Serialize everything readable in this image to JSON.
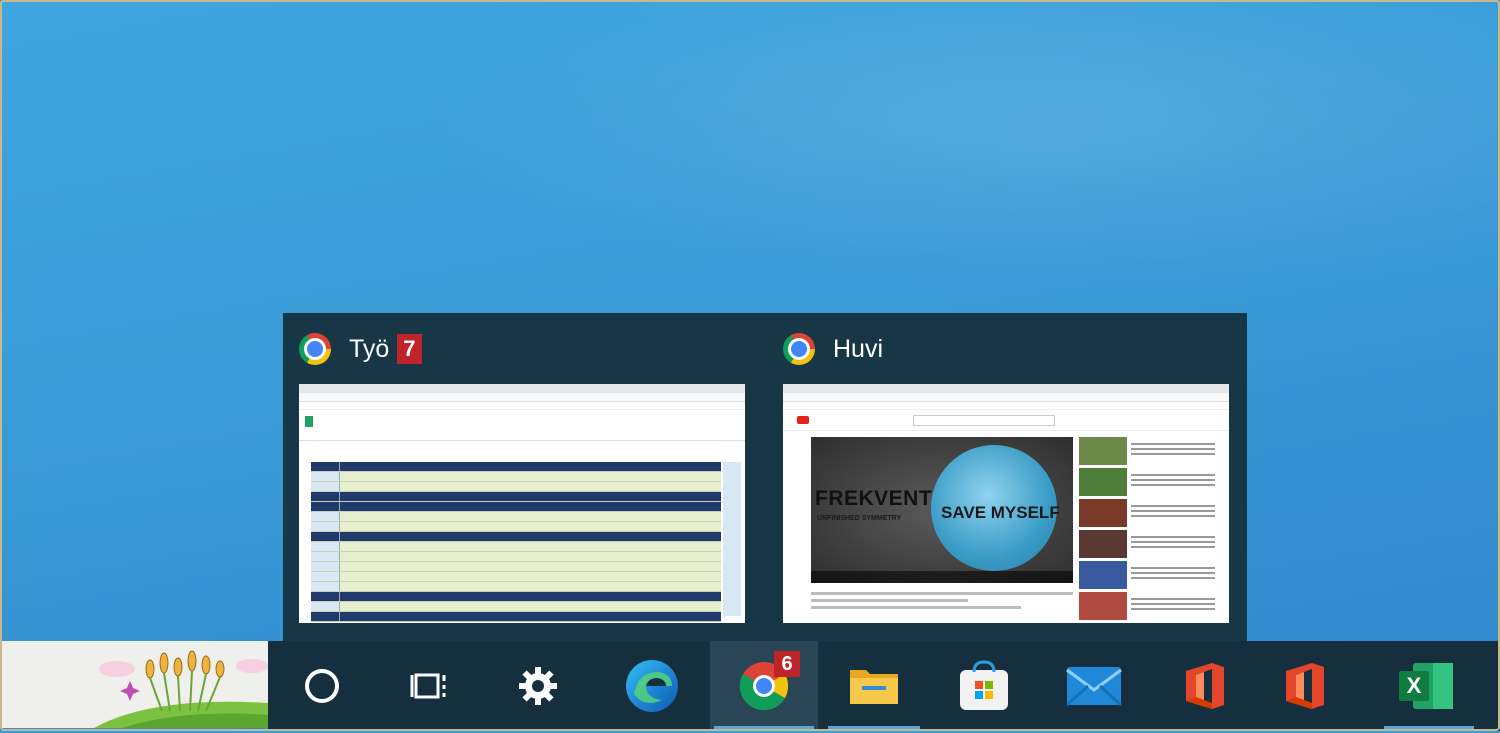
{
  "desktop": {
    "background_color": "#3a9ad7"
  },
  "popup": {
    "groups": [
      {
        "title": "Työ",
        "badge": "7",
        "app_icon": "chrome-icon",
        "thumbnail": "spreadsheet-window"
      },
      {
        "title": "Huvi",
        "badge": "",
        "app_icon": "chrome-icon",
        "thumbnail": "youtube-window"
      }
    ],
    "video_thumb": {
      "artist": "FREKVENT",
      "album": "UNFINISHED SYMMETRY",
      "song": "SAVE MYSELF"
    }
  },
  "taskbar": {
    "items": [
      {
        "name": "search-button",
        "icon": "circle-icon"
      },
      {
        "name": "task-view-button",
        "icon": "task-view-icon"
      },
      {
        "name": "settings-button",
        "icon": "gear-icon"
      },
      {
        "name": "edge-button",
        "icon": "edge-icon"
      },
      {
        "name": "chrome-button",
        "icon": "chrome-icon",
        "badge": "6",
        "active": true
      },
      {
        "name": "file-explorer-button",
        "icon": "folder-icon"
      },
      {
        "name": "store-button",
        "icon": "store-icon"
      },
      {
        "name": "mail-button",
        "icon": "mail-icon"
      },
      {
        "name": "office-button",
        "icon": "office-icon"
      },
      {
        "name": "office-button-2",
        "icon": "office-icon"
      },
      {
        "name": "excel-button",
        "icon": "excel-icon",
        "label": "X"
      }
    ],
    "accent_color": "#5aa7d6"
  },
  "badge_color": "#c0242b"
}
